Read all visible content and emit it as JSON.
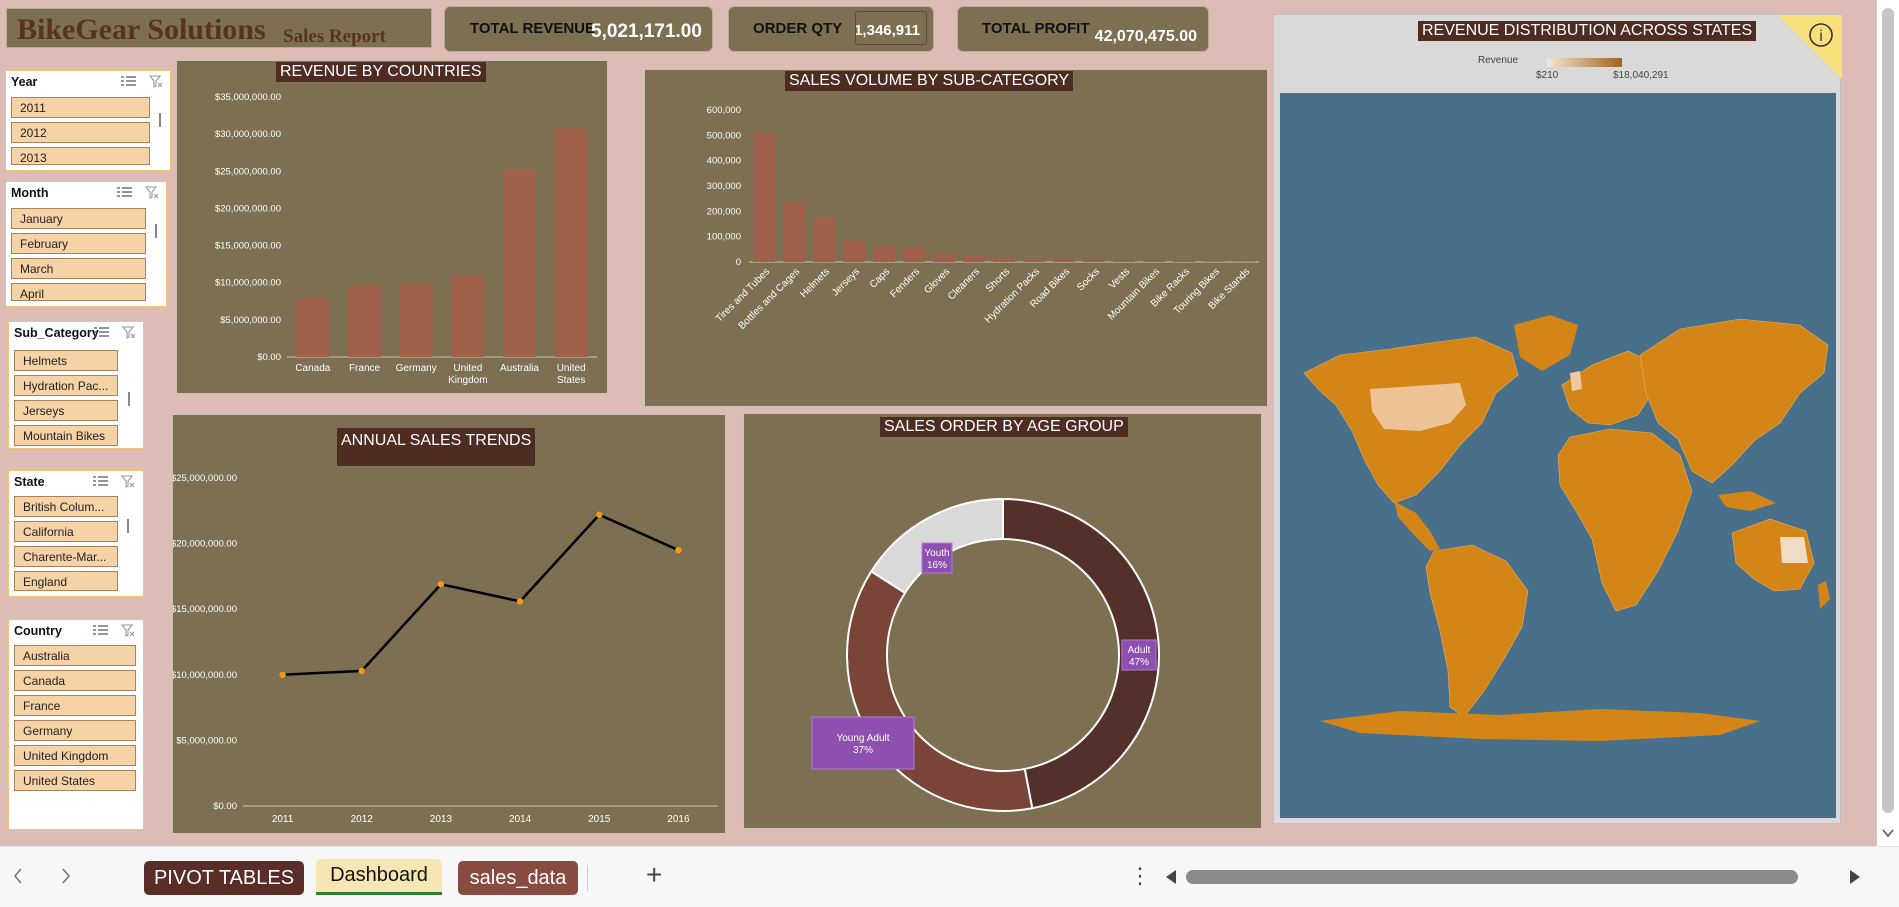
{
  "title": {
    "main": "BikeGear Solutions",
    "sub": "Sales Report"
  },
  "kpis": {
    "revenue": {
      "label": "TOTAL REVENUE",
      "value": "5,021,171.00"
    },
    "order_qty": {
      "label": "ORDER QTY",
      "value": "1,346,911"
    },
    "profit": {
      "label": "TOTAL PROFIT",
      "value": "42,070,475.00"
    }
  },
  "slicers": {
    "year": {
      "title": "Year",
      "items": [
        "2011",
        "2012",
        "2013"
      ]
    },
    "month": {
      "title": "Month",
      "items": [
        "January",
        "February",
        "March",
        "April"
      ]
    },
    "subcat": {
      "title": "Sub_Category",
      "items": [
        "Helmets",
        "Hydration Pac...",
        "Jerseys",
        "Mountain Bikes"
      ]
    },
    "state": {
      "title": "State",
      "items": [
        "British Colum...",
        "California",
        "Charente-Mar...",
        "England"
      ]
    },
    "country": {
      "title": "Country",
      "items": [
        "Australia",
        "Canada",
        "France",
        "Germany",
        "United Kingdom",
        "United States"
      ]
    }
  },
  "colors": {
    "panel": "#7c6f52",
    "bar": "#a0604a",
    "ocean": "#48708a",
    "land": "#d38518",
    "title_bg": "#4e2c22",
    "slicer_item": "#f6d2a7"
  },
  "map": {
    "title": "REVENUE DISTRIBUTION ACROSS STATES",
    "legend_title": "Revenue",
    "legend_min": "$210",
    "legend_max": "$18,040,291",
    "info_icon": "info-icon"
  },
  "chart_data": [
    {
      "type": "bar",
      "title": "REVENUE BY COUNTRIES",
      "categories": [
        "Canada",
        "France",
        "Germany",
        "United Kingdom",
        "Australia",
        "United States"
      ],
      "values": [
        7900000,
        9700000,
        9800000,
        10900000,
        25300000,
        30800000
      ],
      "yticks": [
        "$0.00",
        "$5,000,000.00",
        "$10,000,000.00",
        "$15,000,000.00",
        "$20,000,000.00",
        "$25,000,000.00",
        "$30,000,000.00",
        "$35,000,000.00"
      ],
      "ylim": [
        0,
        35000000
      ],
      "grid": false
    },
    {
      "type": "bar",
      "title": "SALES VOLUME BY SUB-CATEGORY",
      "categories": [
        "Tires and Tubes",
        "Bottles and Cages",
        "Helmets",
        "Jerseys",
        "Caps",
        "Fenders",
        "Gloves",
        "Cleaners",
        "Shorts",
        "Hydration Packs",
        "Road Bikes",
        "Socks",
        "Vests",
        "Mountain Bikes",
        "Bike Racks",
        "Touring Bikes",
        "Bike Stands"
      ],
      "values": [
        505000,
        235000,
        175000,
        85000,
        62000,
        57000,
        35000,
        25000,
        18000,
        10000,
        8000,
        6000,
        4000,
        3000,
        2000,
        1500,
        1000
      ],
      "yticks": [
        "0",
        "100,000",
        "200,000",
        "300,000",
        "400,000",
        "500,000",
        "600,000"
      ],
      "ylim": [
        0,
        600000
      ],
      "grid": false
    },
    {
      "type": "line",
      "title": "ANNUAL  SALES  TRENDS",
      "x": [
        "2011",
        "2012",
        "2013",
        "2014",
        "2015",
        "2016"
      ],
      "y": [
        10000000,
        10300000,
        16900000,
        15600000,
        22200000,
        19500000
      ],
      "yticks": [
        "$0.00",
        "$5,000,000.00",
        "$10,000,000.00",
        "$15,000,000.00",
        "$20,000,000.00",
        "$25,000,000.00"
      ],
      "ylim": [
        0,
        25000000
      ],
      "grid": false
    },
    {
      "type": "pie",
      "title": "SALES ORDER BY AGE GROUP",
      "donut": true,
      "slices": [
        {
          "label": "Adult",
          "value": 47,
          "display": "47%",
          "color": "#54302a"
        },
        {
          "label": "Young Adult",
          "value": 37,
          "display": "37%",
          "color": "#7b4438"
        },
        {
          "label": "Youth",
          "value": 16,
          "display": "16%",
          "color": "#d9d9d9"
        }
      ]
    }
  ],
  "tabs": [
    "PIVOT TABLES",
    "Dashboard",
    "sales_data"
  ],
  "tabbar": {
    "add": "+",
    "more": "⋮",
    "prev": "‹",
    "next": "›"
  }
}
